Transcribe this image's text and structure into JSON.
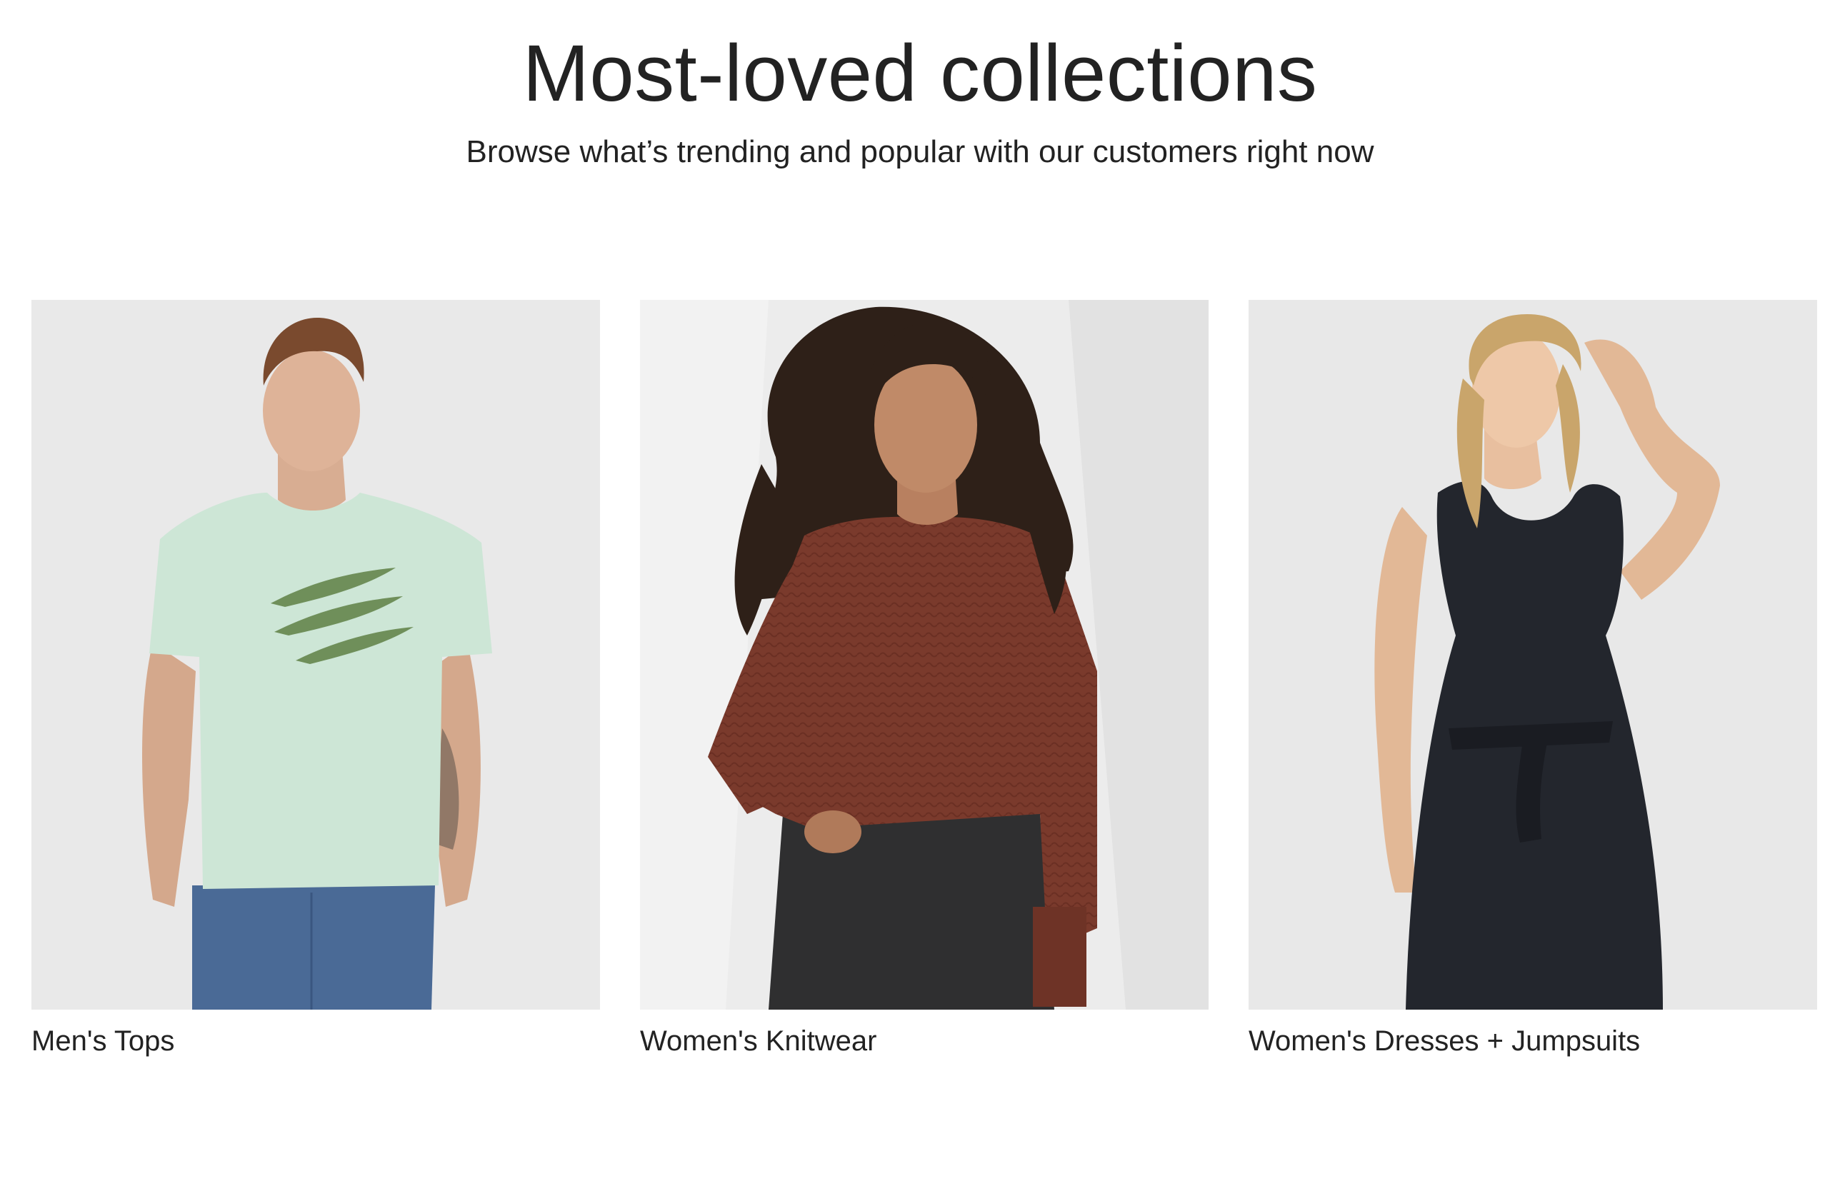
{
  "section": {
    "title": "Most-loved collections",
    "subtitle": "Browse what’s trending and popular with our customers right now"
  },
  "collections": [
    {
      "label": "Men's Tops",
      "image_subject": "man wearing mint green t-shirt with green wave graphic and blue jeans",
      "background": "#e9e9e9"
    },
    {
      "label": "Women's Knitwear",
      "image_subject": "woman with curly hair wearing rust red knit sweater and black jeans",
      "background": "#ececec"
    },
    {
      "label": "Women's Dresses + Jumpsuits",
      "image_subject": "woman with blonde hair wearing black sleeveless tie-front dress",
      "background": "#e8e8e8"
    }
  ]
}
